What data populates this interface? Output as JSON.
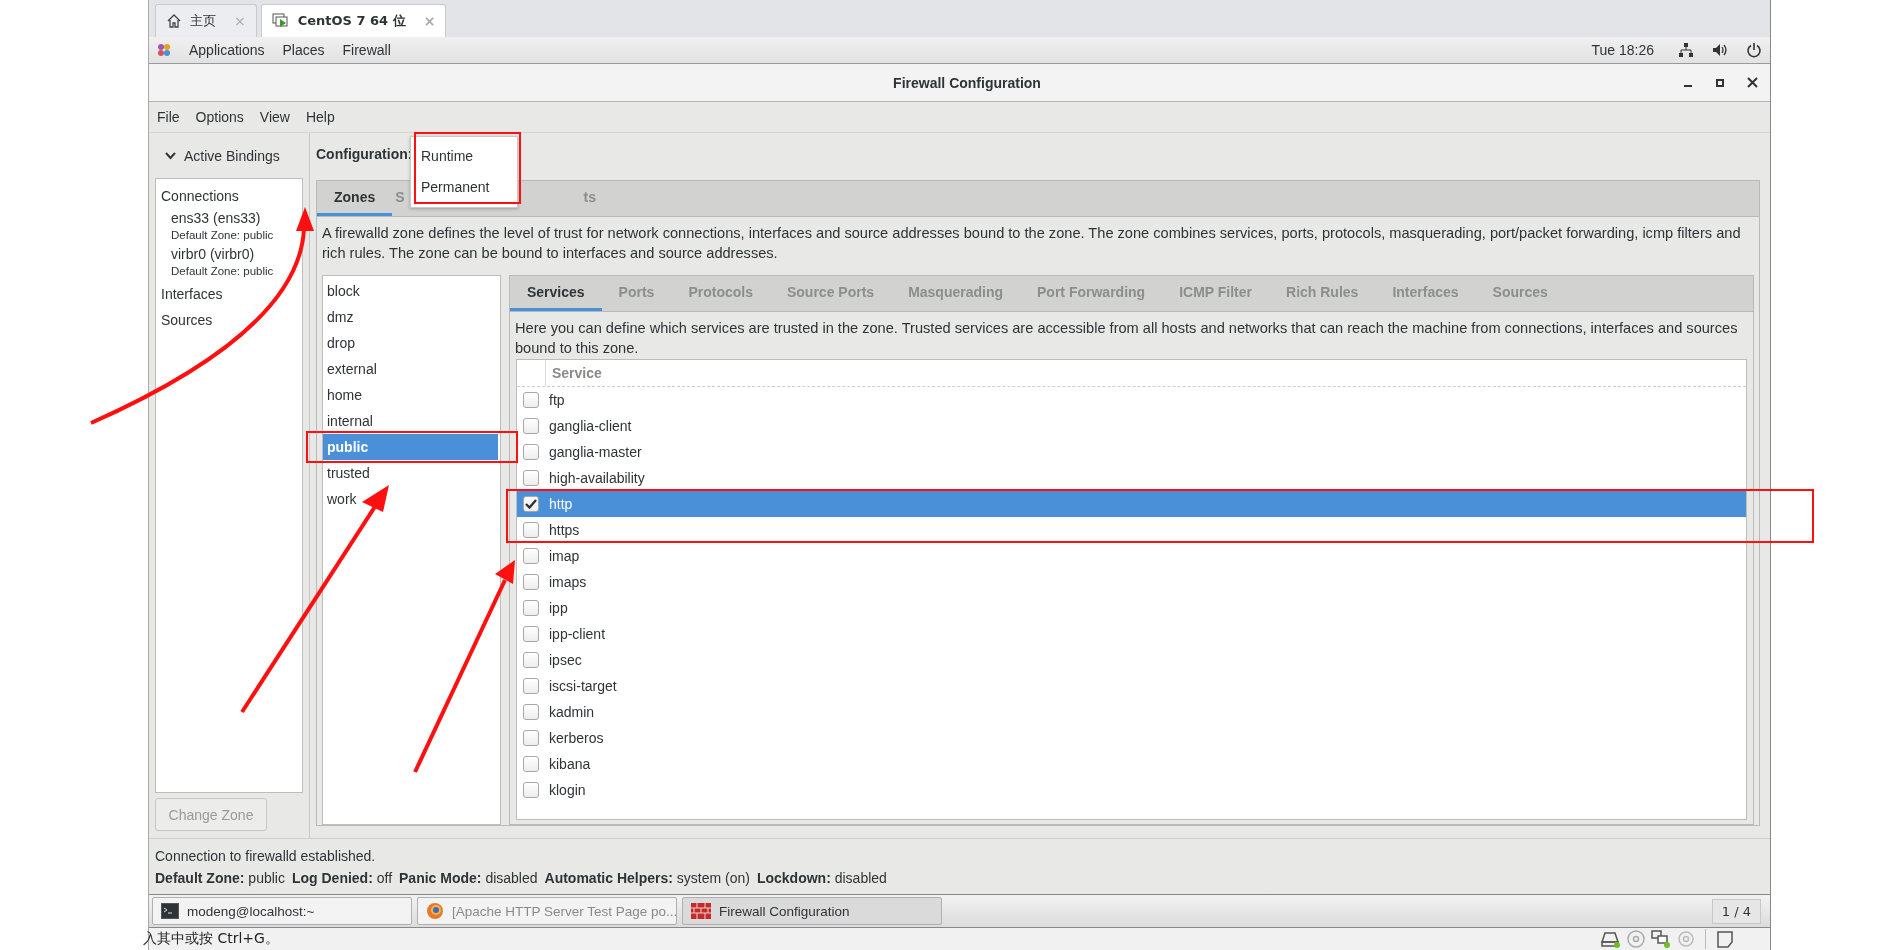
{
  "vm_tabs": [
    {
      "label": "主页",
      "close": "×",
      "selected": false
    },
    {
      "label": "CentOS 7 64 位",
      "close": "×",
      "selected": true
    }
  ],
  "top_bar": {
    "menus": [
      "Applications",
      "Places",
      "Firewall"
    ],
    "clock": "Tue 18:26"
  },
  "window": {
    "title": "Firewall Configuration"
  },
  "menu_bar": [
    "File",
    "Options",
    "View",
    "Help"
  ],
  "bindings": {
    "header": "Active Bindings",
    "expanded": true,
    "sections": [
      {
        "label": "Connections",
        "children": [
          {
            "name": "ens33 (ens33)",
            "zone": "Default Zone: public"
          },
          {
            "name": "virbr0 (virbr0)",
            "zone": "Default Zone: public"
          }
        ]
      },
      {
        "label": "Interfaces"
      },
      {
        "label": "Sources"
      }
    ],
    "button": {
      "label": "Change Zone",
      "disabled": true
    }
  },
  "configuration": {
    "label": "Configuration:",
    "options": [
      "Runtime",
      "Permanent"
    ]
  },
  "tabs": [
    {
      "label": "Zones",
      "selected": true
    },
    {
      "label": "S",
      "selected": false
    },
    {
      "label": "ts",
      "selected": false
    }
  ],
  "description": "A firewalld zone defines the level of trust for network connections, interfaces and source addresses bound to the zone. The zone combines services, ports, protocols, masquerading, port/packet forwarding, icmp filters and rich rules. The zone can be bound to interfaces and source addresses.",
  "zones": [
    {
      "name": "block",
      "selected": false
    },
    {
      "name": "dmz",
      "selected": false
    },
    {
      "name": "drop",
      "selected": false
    },
    {
      "name": "external",
      "selected": false
    },
    {
      "name": "home",
      "selected": false
    },
    {
      "name": "internal",
      "selected": false
    },
    {
      "name": "public",
      "selected": true
    },
    {
      "name": "trusted",
      "selected": false
    },
    {
      "name": "work",
      "selected": false
    }
  ],
  "zone_tabs": [
    {
      "label": "Services",
      "selected": true
    },
    {
      "label": "Ports",
      "selected": false
    },
    {
      "label": "Protocols",
      "selected": false
    },
    {
      "label": "Source Ports",
      "selected": false
    },
    {
      "label": "Masquerading",
      "selected": false
    },
    {
      "label": "Port Forwarding",
      "selected": false
    },
    {
      "label": "ICMP Filter",
      "selected": false
    },
    {
      "label": "Rich Rules",
      "selected": false
    },
    {
      "label": "Interfaces",
      "selected": false
    },
    {
      "label": "Sources",
      "selected": false
    }
  ],
  "services_hint": "Here you can define which services are trusted in the zone. Trusted services are accessible from all hosts and networks that can reach the machine from connections, interfaces and sources bound to this zone.",
  "services_table": {
    "column": "Service",
    "rows": [
      {
        "name": "ftp",
        "checked": false,
        "selected": false
      },
      {
        "name": "ganglia-client",
        "checked": false,
        "selected": false
      },
      {
        "name": "ganglia-master",
        "checked": false,
        "selected": false
      },
      {
        "name": "high-availability",
        "checked": false,
        "selected": false
      },
      {
        "name": "http",
        "checked": true,
        "selected": true
      },
      {
        "name": "https",
        "checked": false,
        "selected": false
      },
      {
        "name": "imap",
        "checked": false,
        "selected": false
      },
      {
        "name": "imaps",
        "checked": false,
        "selected": false
      },
      {
        "name": "ipp",
        "checked": false,
        "selected": false
      },
      {
        "name": "ipp-client",
        "checked": false,
        "selected": false
      },
      {
        "name": "ipsec",
        "checked": false,
        "selected": false
      },
      {
        "name": "iscsi-target",
        "checked": false,
        "selected": false
      },
      {
        "name": "kadmin",
        "checked": false,
        "selected": false
      },
      {
        "name": "kerberos",
        "checked": false,
        "selected": false
      },
      {
        "name": "kibana",
        "checked": false,
        "selected": false
      },
      {
        "name": "klogin",
        "checked": false,
        "selected": false
      }
    ]
  },
  "status": "Connection to firewalld established.",
  "status_items": [
    {
      "label": "Default Zone:",
      "value": "public"
    },
    {
      "label": "Log Denied:",
      "value": "off"
    },
    {
      "label": "Panic Mode:",
      "value": "disabled"
    },
    {
      "label": "Automatic Helpers:",
      "value": "system (on)"
    },
    {
      "label": "Lockdown:",
      "value": "disabled"
    }
  ],
  "taskbar": [
    {
      "label": "modeng@localhost:~",
      "kind": "terminal",
      "selected": false,
      "minimized": false
    },
    {
      "label": "[Apache HTTP Server Test Page po...",
      "kind": "browser",
      "selected": false,
      "minimized": true
    },
    {
      "label": "Firewall Configuration",
      "kind": "firewall",
      "selected": true,
      "minimized": false
    }
  ],
  "pager": "1 / 4",
  "vm_hint": "入其中或按 Ctrl+G。"
}
